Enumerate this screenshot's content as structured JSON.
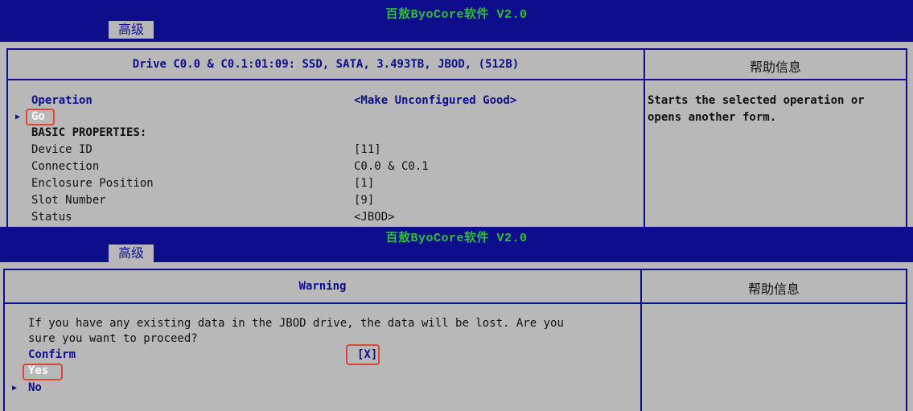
{
  "screen1": {
    "title": "百敖ByoCore软件 V2.0",
    "tab": "高级",
    "drive_header": "Drive C0.0 & C0.1:01:09: SSD, SATA, 3.493TB, JBOD, (512B)",
    "help_header": "帮助信息",
    "operation_label": "Operation",
    "operation_value": "<Make Unconfigured Good>",
    "go_label": "Go",
    "basic_properties": "BASIC PROPERTIES:",
    "properties": [
      {
        "label": "Device ID",
        "value": "[11]"
      },
      {
        "label": "Connection",
        "value": "C0.0 & C0.1"
      },
      {
        "label": "Enclosure Position",
        "value": "[1]"
      },
      {
        "label": "Slot Number",
        "value": "[9]"
      },
      {
        "label": "Status",
        "value": "<JBOD>"
      }
    ],
    "help_text_line1": "Starts the selected operation or",
    "help_text_line2": "opens another form."
  },
  "screen2": {
    "title": "百敖ByoCore软件 V2.0",
    "tab": "高级",
    "warning_header": "Warning",
    "help_header": "帮助信息",
    "warning_line1": "If you have any existing data in the JBOD drive, the data will be lost. Are you",
    "warning_line2": "sure you want to proceed?",
    "confirm_label": "Confirm",
    "confirm_value": "[X]",
    "yes_label": "Yes",
    "no_label": "No"
  },
  "colors": {
    "title_bar": "#0e0e8c",
    "title_text": "#2fbf3a",
    "background": "#b8b8b8",
    "highlight_box": "#e0453a"
  }
}
